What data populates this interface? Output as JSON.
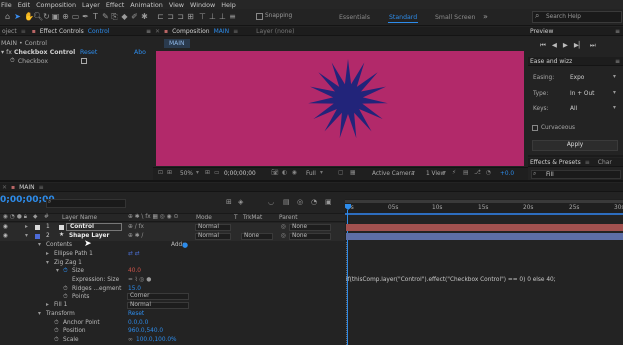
{
  "menu": [
    "File",
    "Edit",
    "Composition",
    "Layer",
    "Effect",
    "Animation",
    "View",
    "Window",
    "Help"
  ],
  "toolbar": {
    "snapping_label": "Snapping",
    "workspaces": [
      "Essentials",
      "Standard",
      "Small Screen"
    ],
    "active_workspace": "Standard",
    "search_placeholder": "Search Help"
  },
  "project_panel": {
    "tab_project": "oject",
    "tab_effect_controls": "Effect Controls",
    "tab_effect_controls_target": "Control",
    "header": "MAIN • Control",
    "effect_name": "Checkbox Control",
    "reset_label": "Reset",
    "about_label": "Abo",
    "checkbox_label": "Checkbox"
  },
  "composition_panel": {
    "tab_label": "Composition",
    "tab_target": "MAIN",
    "layer_tab": "Layer (none)",
    "breadcrumb": "MAIN",
    "zoom": "50%",
    "timecode": "0;00;00;00",
    "resolution": "Full",
    "camera": "Active Camera",
    "view": "1 View",
    "exposure": "+0.0",
    "bg_color": "#b2296a",
    "star_color": "#22247a"
  },
  "preview_panel": {
    "tab": "Preview",
    "ease_tab": "Ease and wizz",
    "easing_label": "Easing:",
    "easing_value": "Expo",
    "type_label": "Type:",
    "type_value": "In + Out",
    "keys_label": "Keys:",
    "keys_value": "All",
    "curvaceous_label": "Curvaceous",
    "apply_label": "Apply"
  },
  "effects_panel": {
    "tab": "Effects & Presets",
    "tab2": "Char",
    "search_value": "Fill"
  },
  "timeline": {
    "tab": "MAIN",
    "timecode": "0;00;00;00",
    "columns": {
      "layer_name": "Layer Name",
      "mode": "Mode",
      "t": "T",
      "trkmat": "TrkMat",
      "parent": "Parent"
    },
    "ruler_labels": [
      "0s",
      "05s",
      "10s",
      "15s",
      "20s",
      "25s",
      "30s"
    ],
    "layers": [
      {
        "num": "1",
        "name": "Control",
        "mode": "Normal",
        "trkmat": "",
        "parent": "None",
        "color": "#d8d8d8",
        "bar": "#a2514f"
      },
      {
        "num": "2",
        "name": "Shape Layer",
        "mode": "Normal",
        "trkmat": "None",
        "parent": "None",
        "color": "#4d6bd8",
        "bar": "#5d6ea6"
      }
    ],
    "properties": {
      "contents": "Contents",
      "add_label": "Add:",
      "ellipse_path": "Ellipse Path 1",
      "zigzag": "Zig Zag 1",
      "size_label": "Size",
      "size_value": "40.0",
      "expression_label": "Expression: Size",
      "ridges_label": "Ridges ...egment",
      "ridges_value": "15.0",
      "points_label": "Points",
      "points_value": "Corner",
      "fill_label": "Fill 1",
      "fill_mode": "Normal",
      "transform_label": "Transform",
      "transform_reset": "Reset",
      "anchor_label": "Anchor Point",
      "anchor_value": "0.0,0.0",
      "position_label": "Position",
      "position_value": "960.0,540.0",
      "scale_label": "Scale",
      "scale_value": "100.0,100.0%"
    },
    "expression_text": "if(thisComp.layer(\"Control\").effect(\"Checkbox Control\") == 0) 0 else 40;"
  }
}
